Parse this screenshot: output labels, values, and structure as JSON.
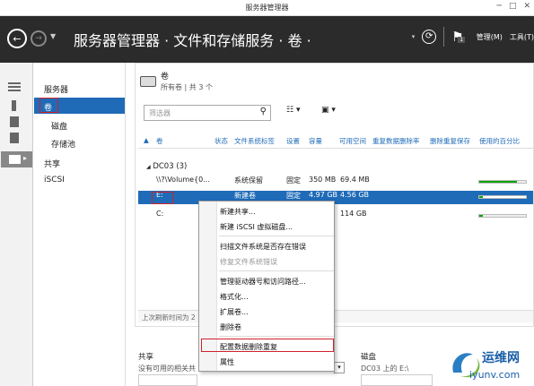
{
  "window": {
    "title": "服务器管理器"
  },
  "header": {
    "breadcrumb": "服务器管理器 · 文件和存储服务 · 卷 ·",
    "manage": "管理(M)",
    "tools": "工具(T)",
    "flag_badge": "1"
  },
  "nav": {
    "items": [
      {
        "label": "服务器"
      },
      {
        "label": "卷"
      },
      {
        "label": "磁盘"
      },
      {
        "label": "存储池"
      },
      {
        "label": "共享"
      },
      {
        "label": "iSCSI"
      }
    ]
  },
  "volumes": {
    "title": "卷",
    "subtitle": "所有卷 | 共 3 个",
    "search_placeholder": "筛选器",
    "columns": [
      "卷",
      "状态",
      "文件系统标签",
      "设置",
      "容量",
      "可用空间",
      "重复数据删除率",
      "删除重复保存",
      "使用的百分比"
    ],
    "group": "DC03 (3)",
    "rows": [
      {
        "volume": "\\\\?\\Volume{0...",
        "label": "系统保留",
        "provision": "固定",
        "capacity": "350 MB",
        "free": "69.4 MB",
        "used": 0.8
      },
      {
        "volume": "E:",
        "label": "新建卷",
        "provision": "固定",
        "capacity": "4.97 GB",
        "free": "4.56 GB",
        "used": 0.08
      },
      {
        "volume": "C:",
        "label": "",
        "provision": "",
        "capacity": "",
        "free": "114 GB",
        "used": 0.07
      }
    ],
    "last_refresh": "上次刷新时间为 2"
  },
  "context_menu": {
    "items": [
      {
        "label": "新建共享..."
      },
      {
        "label": "新建 iSCSI 虚拟磁盘..."
      },
      {
        "label": "扫描文件系统是否存在错误"
      },
      {
        "label": "修复文件系统错误"
      },
      {
        "label": "管理驱动器号和访问路径..."
      },
      {
        "label": "格式化..."
      },
      {
        "label": "扩展卷..."
      },
      {
        "label": "删除卷"
      },
      {
        "label": "配置数据删除重复"
      },
      {
        "label": "属性"
      }
    ]
  },
  "bottom": {
    "shares_title": "共享",
    "shares_text": "没有可用的相关共",
    "disk_title": "磁盘",
    "disk_text": "DC03 上的 E:\\"
  },
  "watermark": {
    "cn": "运维网",
    "url": "iyunv.com"
  }
}
